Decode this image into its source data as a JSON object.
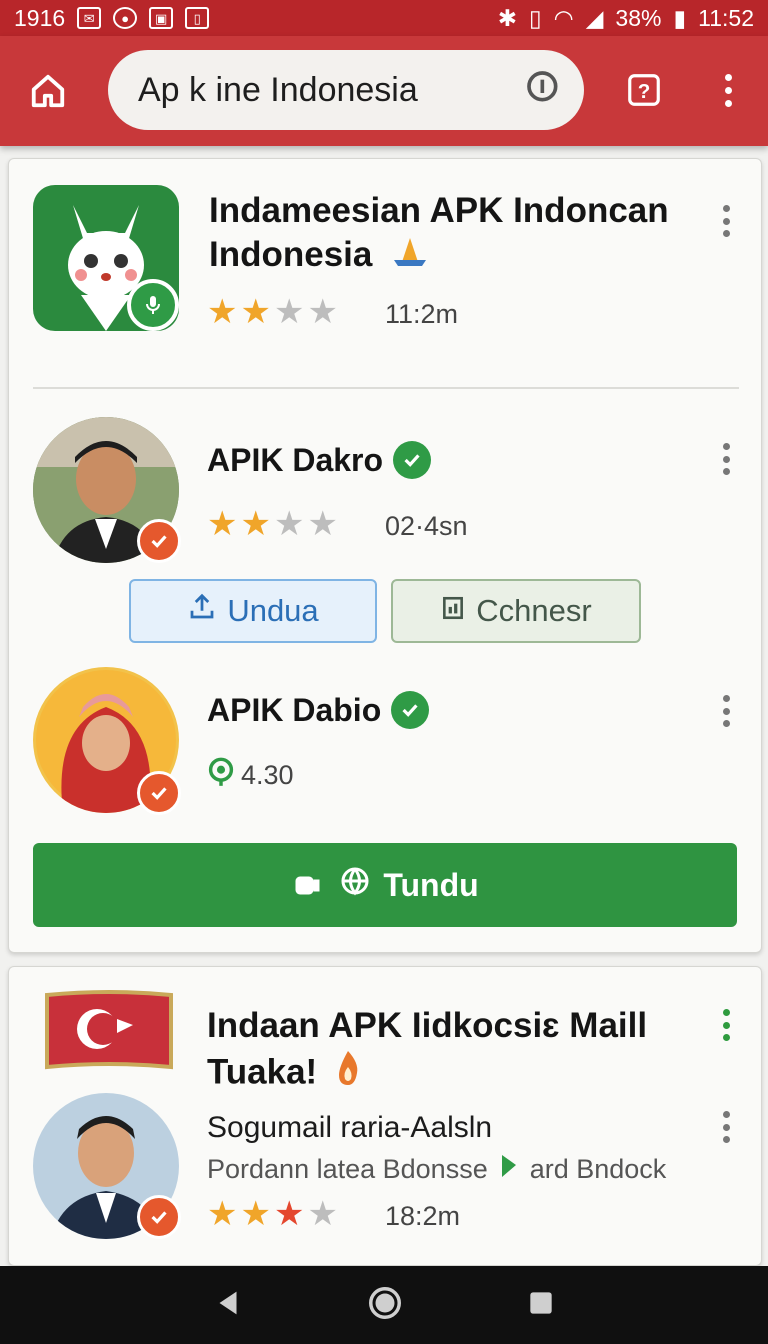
{
  "status_bar": {
    "left_text": "1916",
    "battery_percent": "38%",
    "time": "11:52"
  },
  "app_bar": {
    "search_text": "Ap k ine Indonesia"
  },
  "card_one": {
    "app_title_line1": "Indameesian APK Indoncan",
    "app_title_line2": "Indonesia",
    "app_rating_stars": 2,
    "app_size": "11:2m",
    "item1": {
      "name": "APIK Dakro",
      "rating_stars": 2,
      "meta": "02·4sn"
    },
    "download_button": "Undua",
    "change_button": "Cchnesr",
    "item2": {
      "name": "APIK Dabio",
      "score": "4.30"
    },
    "big_button": "Tundu"
  },
  "card_two": {
    "title_line1": "Indaan APK Iidkocsiɛ Maill",
    "title_line2": "Tuaka!",
    "user_name": "Sogumail raria-Aalsln",
    "subtitle_left": "Pordann latea Bdonsse",
    "subtitle_right": "ard Bndock",
    "rating_stars": 3,
    "meta": "18:2m"
  },
  "colors": {
    "primary": "#c8383a",
    "status_bar": "#b8262a",
    "accent_green": "#2f9441",
    "star": "#f0a52a",
    "badge": "#e5582d"
  }
}
